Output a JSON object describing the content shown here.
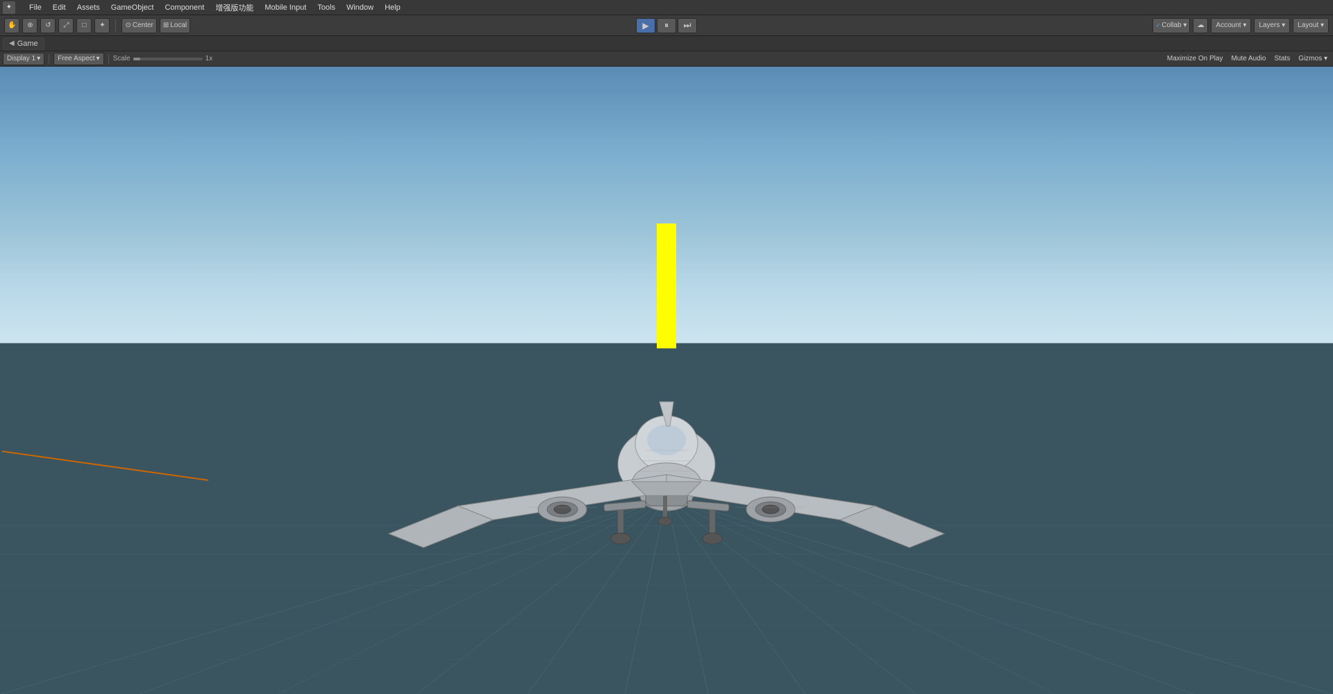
{
  "menu": {
    "items": [
      "File",
      "Edit",
      "Assets",
      "GameObject",
      "Component",
      "增强版功能",
      "Mobile Input",
      "Tools",
      "Window",
      "Help"
    ]
  },
  "toolbar": {
    "tools": [
      "⊕",
      "↔",
      "↺",
      "⤢",
      "□",
      "✦"
    ],
    "pivot_label": "Center",
    "space_label": "Local",
    "collab_label": "Collab ▾",
    "cloud_icon": "☁",
    "account_label": "Account ▾",
    "layers_label": "Layers ▾",
    "layout_label": "Layout ▾"
  },
  "game_tab": {
    "label": "Game"
  },
  "game_toolbar": {
    "display_label": "Display 1",
    "aspect_label": "Free Aspect",
    "scale_label": "Scale",
    "scale_value": "1x",
    "maximize_on_play": "Maximize On Play",
    "mute_audio": "Mute Audio",
    "stats": "Stats",
    "gizmos": "Gizmos ▾"
  },
  "viewport": {
    "yellow_rect_visible": true
  }
}
